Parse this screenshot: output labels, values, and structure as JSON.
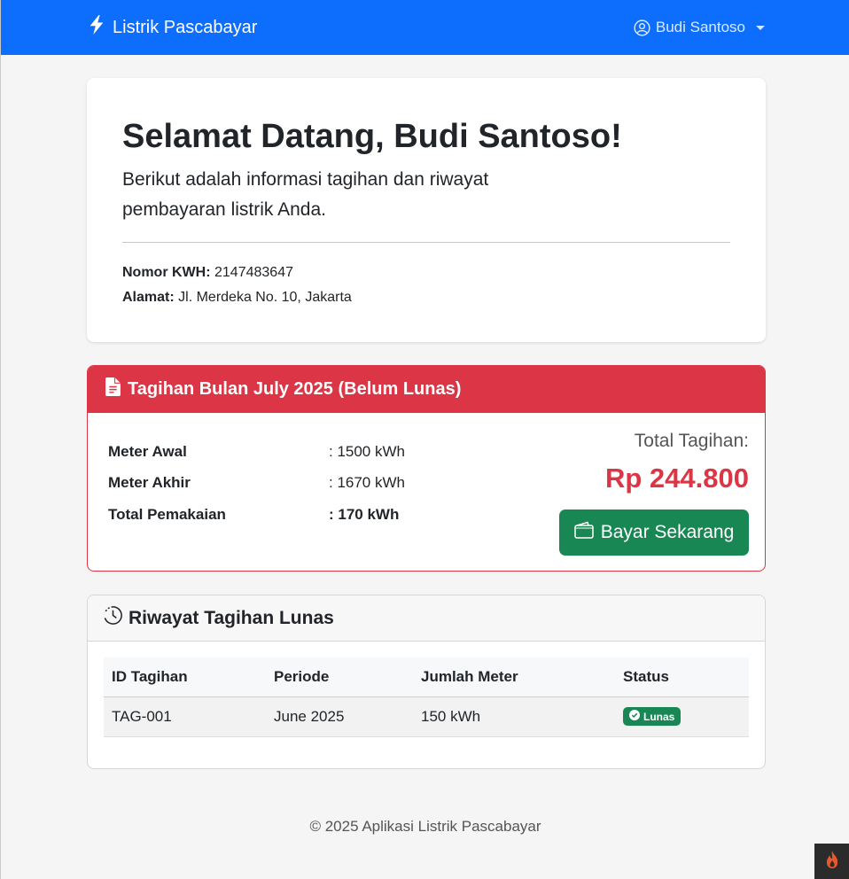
{
  "navbar": {
    "brand": "Listrik Pascabayar",
    "user_name": "Budi Santoso"
  },
  "welcome": {
    "title": "Selamat Datang, Budi Santoso!",
    "lead": "Berikut adalah informasi tagihan dan riwayat pembayaran listrik Anda.",
    "kwh_label": "Nomor KWH:",
    "kwh_value": "2147483647",
    "address_label": "Alamat:",
    "address_value": "Jl. Merdeka No. 10, Jakarta"
  },
  "bill": {
    "title": "Tagihan Bulan July 2025 (Belum Lunas)",
    "rows": [
      {
        "label": "Meter Awal",
        "value": ": 1500 kWh"
      },
      {
        "label": "Meter Akhir",
        "value": ": 1670 kWh"
      },
      {
        "label": "Total Pemakaian",
        "value": ": 170 kWh"
      }
    ],
    "total_label": "Total Tagihan:",
    "total_amount": "Rp 244.800",
    "pay_button": "Bayar Sekarang"
  },
  "history": {
    "title": "Riwayat Tagihan Lunas",
    "columns": [
      "ID Tagihan",
      "Periode",
      "Jumlah Meter",
      "Status"
    ],
    "rows": [
      {
        "id": "TAG-001",
        "period": "June 2025",
        "meter": "150 kWh",
        "status": "Lunas"
      }
    ]
  },
  "footer": {
    "text": "© 2025 Aplikasi Listrik Pascabayar"
  },
  "colors": {
    "primary": "#0d6efd",
    "danger": "#dc3545",
    "success": "#198754"
  },
  "icons": {
    "brand": "lightning-icon",
    "user": "user-circle-icon",
    "bill": "file-text-icon",
    "pay": "wallet-icon",
    "history": "clock-history-icon",
    "status": "check-circle-icon",
    "corner": "fire-icon"
  }
}
